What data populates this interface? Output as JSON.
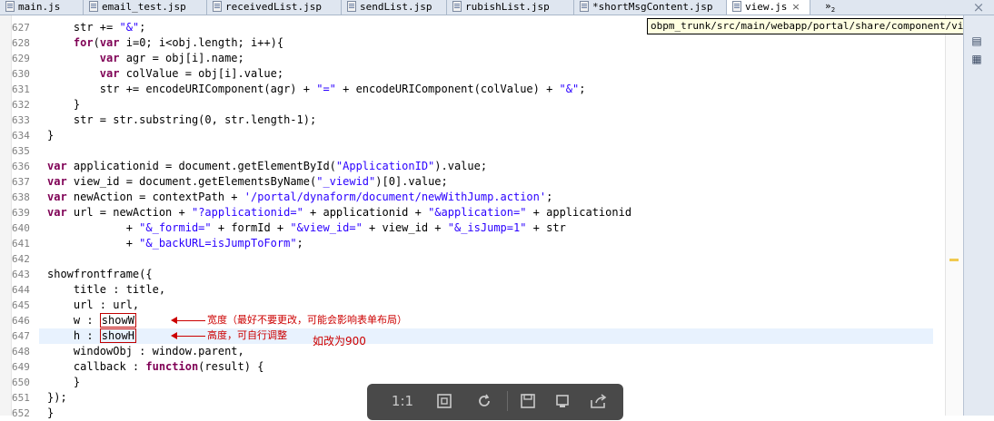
{
  "tabs": [
    {
      "label": "main.js",
      "active": false
    },
    {
      "label": "email_test.jsp",
      "active": false
    },
    {
      "label": "receivedList.jsp",
      "active": false
    },
    {
      "label": "sendList.jsp",
      "active": false
    },
    {
      "label": "rubishList.jsp",
      "active": false
    },
    {
      "label": "*shortMsgContent.jsp",
      "active": false
    },
    {
      "label": "view.js",
      "active": true
    }
  ],
  "tab_overflow": {
    "symbol": "»",
    "count": "2"
  },
  "close_icon": "×",
  "file_path_tooltip": "obpm_trunk/src/main/webapp/portal/share/component/view/view.js",
  "editor": {
    "lines": [
      {
        "n": "627"
      },
      {
        "n": "628"
      },
      {
        "n": "629"
      },
      {
        "n": "630"
      },
      {
        "n": "631"
      },
      {
        "n": "632"
      },
      {
        "n": "633"
      },
      {
        "n": "634"
      },
      {
        "n": "635"
      },
      {
        "n": "636"
      },
      {
        "n": "637"
      },
      {
        "n": "638"
      },
      {
        "n": "639"
      },
      {
        "n": "640"
      },
      {
        "n": "641"
      },
      {
        "n": "642"
      },
      {
        "n": "643"
      },
      {
        "n": "644"
      },
      {
        "n": "645"
      },
      {
        "n": "646"
      },
      {
        "n": "647"
      },
      {
        "n": "648"
      },
      {
        "n": "649"
      },
      {
        "n": "650"
      },
      {
        "n": "651"
      },
      {
        "n": "652"
      }
    ],
    "highlighted_line": "647",
    "code": {
      "l627": {
        "a": "    str += ",
        "b": "\"&\"",
        "c": ";"
      },
      "l628": {
        "kw1": "for",
        "a": "(",
        "kw2": "var",
        "b": " i=0; i<obj.length; i++){"
      },
      "l629": {
        "kw": "var",
        "a": " agr = obj[i].name;"
      },
      "l630": {
        "kw": "var",
        "a": " colValue = obj[i].value;"
      },
      "l631": {
        "a": "        str += encodeURIComponent(agr) + ",
        "s1": "\"=\"",
        "b": " + encodeURIComponent(colValue) + ",
        "s2": "\"&\"",
        "c": ";"
      },
      "l632": "    }",
      "l633": "    str = str.substring(0, str.length-1);",
      "l634": "}",
      "l636": {
        "kw": "var",
        "a": " applicationid = document.getElementById(",
        "s": "\"ApplicationID\"",
        "b": ").value;"
      },
      "l637": {
        "kw": "var",
        "a": " view_id = document.getElementsByName(",
        "s": "\"_viewid\"",
        "b": ")[0].value;"
      },
      "l638": {
        "kw": "var",
        "a": " newAction = contextPath + ",
        "s": "'/portal/dynaform/document/newWithJump.action'",
        "b": ";"
      },
      "l639": {
        "kw": "var",
        "a": " url = newAction + ",
        "s1": "\"?applicationid=\"",
        "b": " + applicationid + ",
        "s2": "\"&application=\"",
        "c": " + applicationid"
      },
      "l640": {
        "a": "            + ",
        "s1": "\"&_formid=\"",
        "b": " + formId + ",
        "s2": "\"&view_id=\"",
        "c": " + view_id + ",
        "s3": "\"&_isJump=1\"",
        "d": " + str"
      },
      "l641": {
        "a": "            + ",
        "s": "\"&_backURL=isJumpToForm\"",
        "b": ";"
      },
      "l643": "showfrontframe({",
      "l644": "    title : title,",
      "l645": "    url : url,",
      "l646": {
        "a": "    w : ",
        "box": "showW"
      },
      "l647": {
        "a": "    h : ",
        "box": "showH"
      },
      "l648": "    windowObj : window.parent,",
      "l649": {
        "a": "    callback : ",
        "kw": "function",
        "b": "(result) {"
      },
      "l650": "    }",
      "l651": "});",
      "l652": "}"
    }
  },
  "annotations": {
    "width_note": "宽度（最好不要更改，可能会影响表单布局）",
    "height_note": "高度，可自行调整",
    "change_note": "如改为900"
  },
  "viewer_toolbar": {
    "actual_size": "1:1",
    "colors": {
      "bg": "#3a3a3a",
      "icon": "#c9c9c9"
    }
  },
  "colors": {
    "keyword": "#7f0055",
    "string": "#2a00ff",
    "annotation": "#cc0000",
    "current_line": "#e8f2fe"
  }
}
